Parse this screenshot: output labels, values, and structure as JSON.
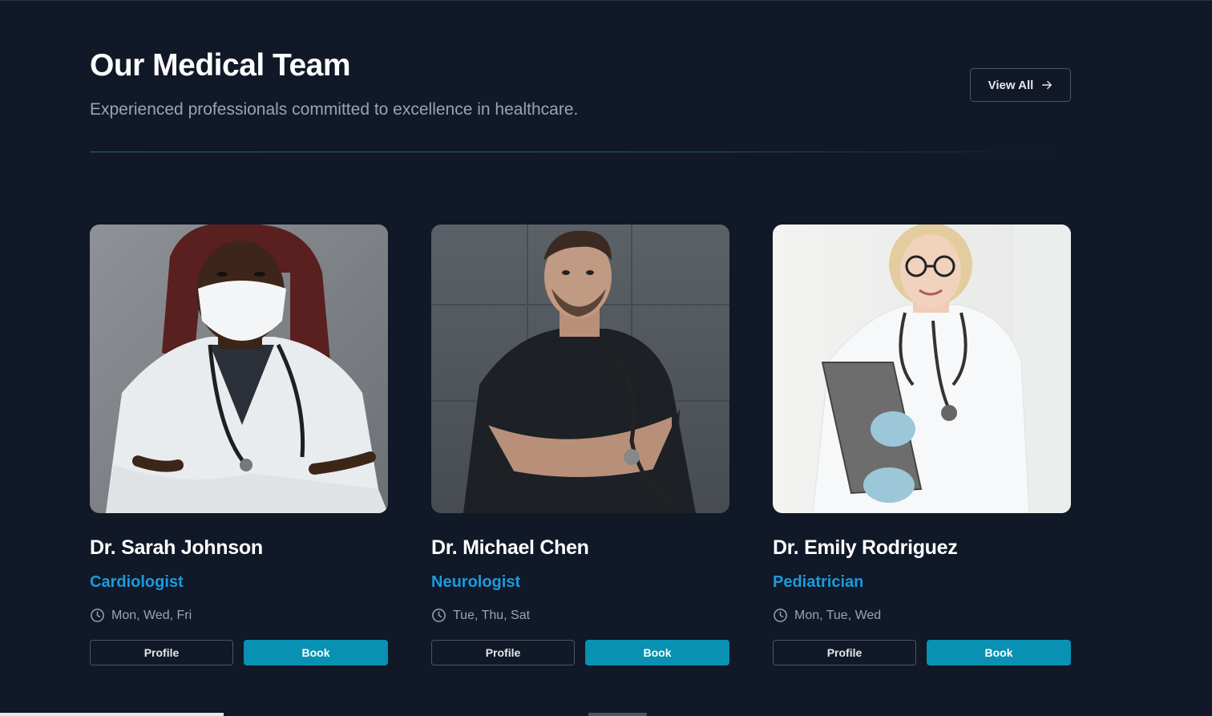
{
  "header": {
    "title": "Our Medical Team",
    "subtitle": "Experienced professionals committed to excellence in healthcare.",
    "view_all_label": "View All"
  },
  "doctors": [
    {
      "name": "Dr. Sarah Johnson",
      "specialty": "Cardiologist",
      "schedule": "Mon, Wed, Fri",
      "profile_label": "Profile",
      "book_label": "Book"
    },
    {
      "name": "Dr. Michael Chen",
      "specialty": "Neurologist",
      "schedule": "Tue, Thu, Sat",
      "profile_label": "Profile",
      "book_label": "Book"
    },
    {
      "name": "Dr. Emily Rodriguez",
      "specialty": "Pediatrician",
      "schedule": "Mon, Tue, Wed",
      "profile_label": "Profile",
      "book_label": "Book"
    }
  ],
  "icons": {
    "view_all": "arrow-right-icon",
    "schedule": "clock-icon"
  },
  "colors": {
    "background": "#111827",
    "accent": "#1b9bdc",
    "book_button": "#0891b2",
    "muted_text": "#9ca3af"
  }
}
